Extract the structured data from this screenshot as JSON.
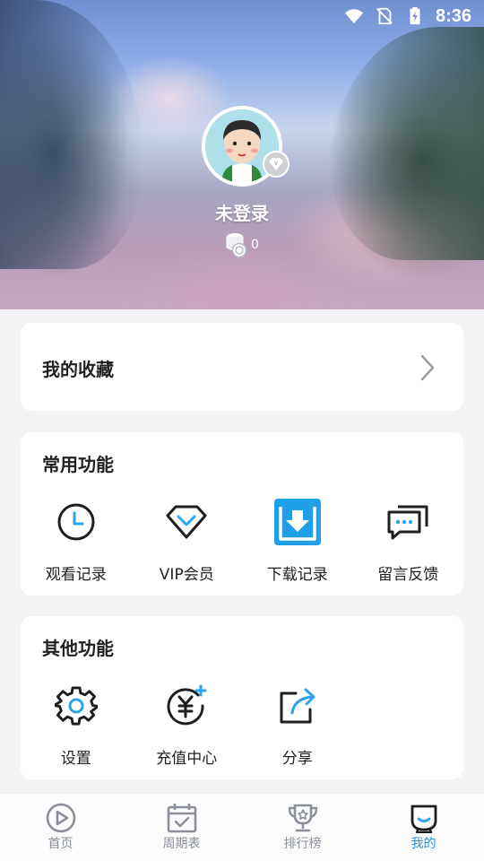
{
  "status_bar": {
    "time": "8:36"
  },
  "profile": {
    "username": "未登录",
    "coins": "0"
  },
  "favorites": {
    "label": "我的收藏"
  },
  "common": {
    "title": "常用功能",
    "items": [
      {
        "label": "观看记录",
        "icon": "clock-icon"
      },
      {
        "label": "VIP会员",
        "icon": "diamond-icon"
      },
      {
        "label": "下载记录",
        "icon": "download-icon"
      },
      {
        "label": "留言反馈",
        "icon": "feedback-icon"
      }
    ]
  },
  "other": {
    "title": "其他功能",
    "items": [
      {
        "label": "设置",
        "icon": "gear-icon"
      },
      {
        "label": "充值中心",
        "icon": "yuan-recharge-icon"
      },
      {
        "label": "分享",
        "icon": "share-icon"
      }
    ]
  },
  "nav": {
    "items": [
      {
        "label": "首页",
        "icon": "play-icon"
      },
      {
        "label": "周期表",
        "icon": "calendar-icon"
      },
      {
        "label": "排行榜",
        "icon": "trophy-icon"
      },
      {
        "label": "我的",
        "icon": "profile-icon",
        "active": true
      }
    ]
  },
  "colors": {
    "accent": "#2f8fd8",
    "download_bg": "#1f9fe8",
    "text": "#222222",
    "muted": "#8a8f99"
  }
}
